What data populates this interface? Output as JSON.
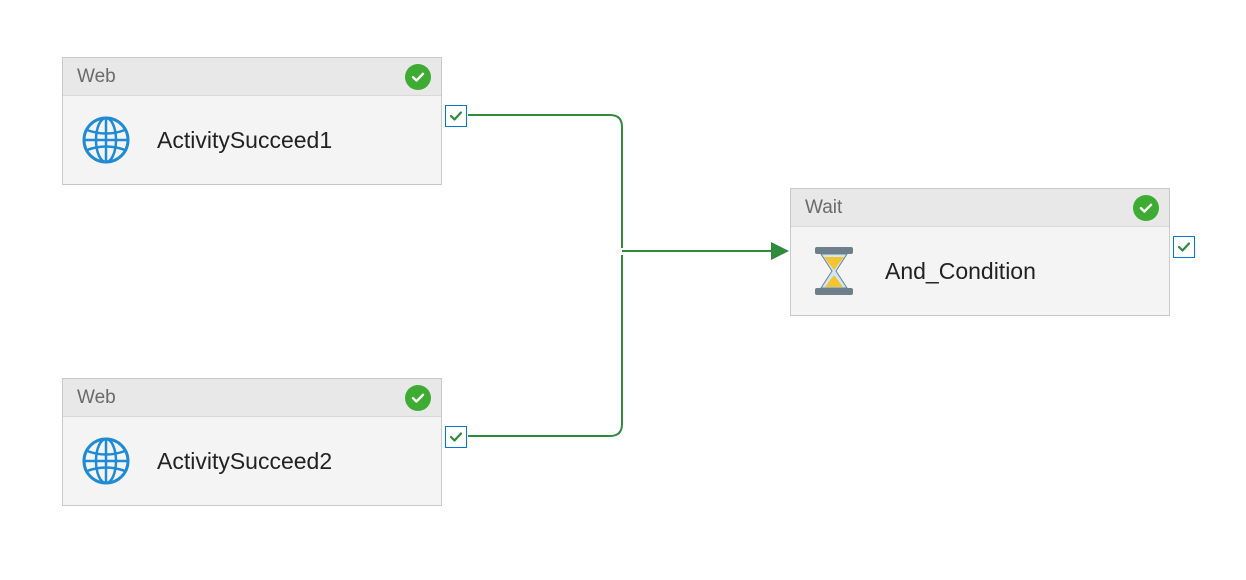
{
  "nodes": {
    "n1": {
      "type_label": "Web",
      "title": "ActivitySucceed1",
      "status": "success",
      "icon": "globe"
    },
    "n2": {
      "type_label": "Web",
      "title": "ActivitySucceed2",
      "status": "success",
      "icon": "globe"
    },
    "n3": {
      "type_label": "Wait",
      "title": "And_Condition",
      "status": "success",
      "icon": "hourglass"
    }
  },
  "colors": {
    "success_green": "#3eab32",
    "connector_green": "#2f8a3d",
    "port_border": "#0078d4",
    "globe_blue": "#1f8ad6",
    "hourglass_yellow": "#f4c430",
    "hourglass_frame": "#6d7f8b"
  },
  "edges": [
    {
      "from": "n1",
      "to": "n3",
      "condition": "success"
    },
    {
      "from": "n2",
      "to": "n3",
      "condition": "success"
    }
  ]
}
